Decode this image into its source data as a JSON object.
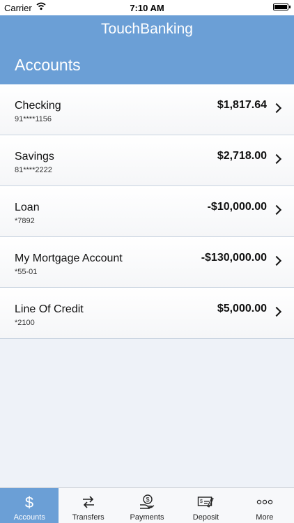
{
  "status": {
    "carrier": "Carrier",
    "time": "7:10 AM",
    "battery": 1.0
  },
  "header": {
    "app_title": "TouchBanking",
    "section_title": "Accounts"
  },
  "accounts": [
    {
      "name": "Checking",
      "number": "91****1156",
      "balance": "$1,817.64"
    },
    {
      "name": "Savings",
      "number": "81****2222",
      "balance": "$2,718.00"
    },
    {
      "name": "Loan",
      "number": "*7892",
      "balance": "-$10,000.00"
    },
    {
      "name": "My Mortgage Account",
      "number": "*55-01",
      "balance": "-$130,000.00"
    },
    {
      "name": "Line Of Credit",
      "number": "*2100",
      "balance": "$5,000.00"
    }
  ],
  "tabs": [
    {
      "label": "Accounts",
      "icon": "dollar-icon",
      "active": true
    },
    {
      "label": "Transfers",
      "icon": "transfer-arrows-icon",
      "active": false
    },
    {
      "label": "Payments",
      "icon": "hand-dollar-icon",
      "active": false
    },
    {
      "label": "Deposit",
      "icon": "check-deposit-icon",
      "active": false
    },
    {
      "label": "More",
      "icon": "ellipsis-icon",
      "active": false
    }
  ],
  "colors": {
    "accent": "#6b9fd6",
    "background": "#eef2f8"
  }
}
